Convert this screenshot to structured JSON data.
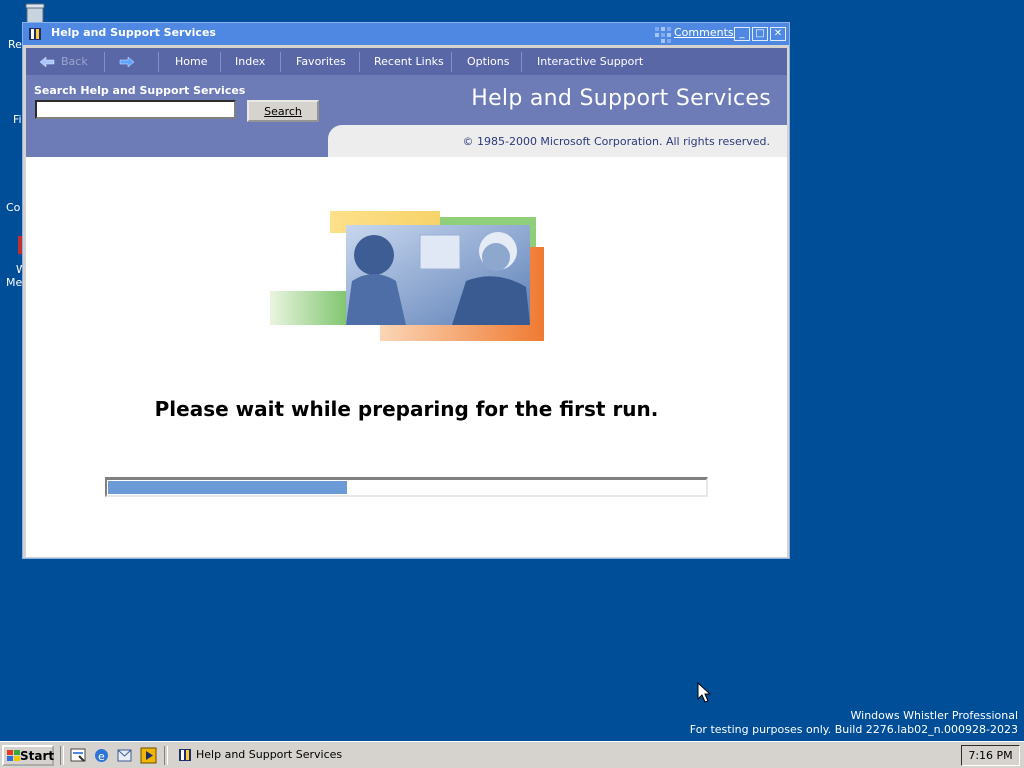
{
  "desktop": {
    "icons": [
      {
        "label": "Re",
        "icon": "recycle-bin-icon"
      },
      {
        "label": "Fi",
        "icon": "folder-icon"
      },
      {
        "label": "Co",
        "icon": "computer-icon"
      },
      {
        "label": "W",
        "icon": "media-icon"
      },
      {
        "label": "Me",
        "icon": "media-icon"
      }
    ],
    "watermark": {
      "line1": "Windows Whistler Professional",
      "line2": "For testing purposes only. Build 2276.lab02_n.000928-2023"
    }
  },
  "window": {
    "title": "Help and Support Services",
    "comments_link": "Comments?",
    "controls": {
      "minimize": "_",
      "maximize": "□",
      "close": "✕"
    },
    "nav": {
      "back": "Back",
      "items": [
        "Home",
        "Index",
        "Favorites",
        "Recent Links",
        "Options",
        "Interactive Support"
      ]
    },
    "search": {
      "title": "Search Help and Support Services",
      "input_value": "",
      "button_label": "Search"
    },
    "brand_title": "Help and Support Services",
    "copyright": "© 1985-2000 Microsoft Corporation. All rights reserved.",
    "content": {
      "message": "Please wait while preparing for the first run.",
      "progress_percent": 40
    }
  },
  "taskbar": {
    "start_label": "Start",
    "quick_launch": [
      "show-desktop-icon",
      "internet-explorer-icon",
      "outlook-icon",
      "media-player-icon"
    ],
    "task_button": "Help and Support Services",
    "clock": "7:16 PM"
  },
  "colors": {
    "desktop": "#004e98",
    "titlebar": "#4e88e3",
    "navbar": "#5a67a7",
    "search_area": "#6d7bb7",
    "progress_fill": "#6a9bd7"
  }
}
